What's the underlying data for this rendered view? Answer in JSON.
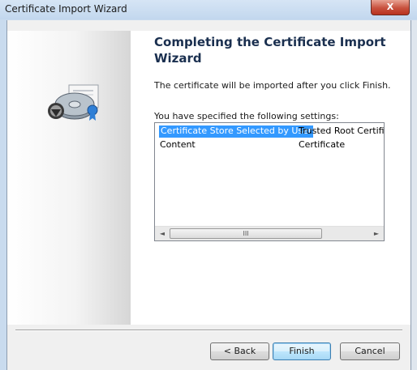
{
  "window": {
    "title": "Certificate Import Wizard",
    "close_label": "X"
  },
  "wizard": {
    "heading": "Completing the Certificate Import Wizard",
    "description": "The certificate will be imported after you click Finish.",
    "settings_label": "You have specified the following settings:",
    "settings": [
      {
        "name": "Certificate Store Selected by User",
        "value": "Trusted Root Certifica",
        "selected": true
      },
      {
        "name": "Content",
        "value": "Certificate",
        "selected": false
      }
    ],
    "scroll_left": "◄",
    "scroll_right": "►",
    "scroll_grip": "III"
  },
  "buttons": {
    "back": "< Back",
    "finish": "Finish",
    "cancel": "Cancel"
  }
}
